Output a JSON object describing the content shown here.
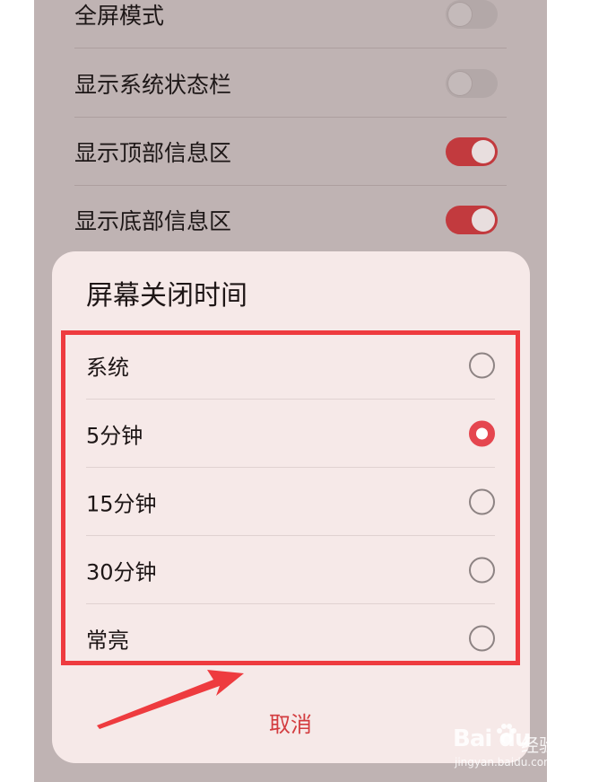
{
  "settings": {
    "rows": [
      {
        "label": "全屏模式",
        "toggle_on": false
      },
      {
        "label": "显示系统状态栏",
        "toggle_on": false
      },
      {
        "label": "显示顶部信息区",
        "toggle_on": true
      },
      {
        "label": "显示底部信息区",
        "toggle_on": true
      }
    ]
  },
  "dialog": {
    "title": "屏幕关闭时间",
    "options": [
      {
        "label": "系统",
        "selected": false
      },
      {
        "label": "5分钟",
        "selected": true
      },
      {
        "label": "15分钟",
        "selected": false
      },
      {
        "label": "30分钟",
        "selected": false
      },
      {
        "label": "常亮",
        "selected": false
      }
    ],
    "cancel_label": "取消"
  },
  "watermark": {
    "brand": "Bai du",
    "cn": "经验",
    "url": "jingyan.baidu.com"
  },
  "colors": {
    "accent": "#e5464f",
    "annotation": "#ee3b3f",
    "toggle_on": "#c23a3e",
    "dialog_bg": "#f6e9e8",
    "screen_bg": "#bfb3b3"
  }
}
